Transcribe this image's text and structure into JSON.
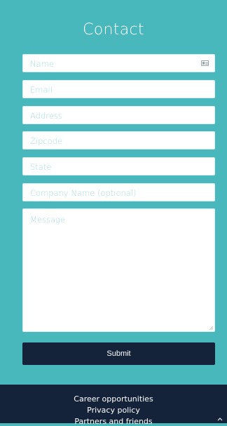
{
  "header": {
    "title": "Contact"
  },
  "form": {
    "name_placeholder": "Name",
    "email_placeholder": "Email",
    "address_placeholder": "Address",
    "zipcode_placeholder": "Zipcode",
    "state_placeholder": "State",
    "company_placeholder": "Company Name (optional)",
    "message_placeholder": "Message",
    "submit_label": "Submit"
  },
  "footer": {
    "links": [
      "Career opportunities",
      "Privacy policy",
      "Partners and friends"
    ]
  },
  "icons": {
    "name_field": "contact-card-icon",
    "back_to_top": "chevron-up-icon"
  },
  "colors": {
    "background": "#49b8bc",
    "dark": "#15233a",
    "placeholder": "#a9dfe0"
  }
}
